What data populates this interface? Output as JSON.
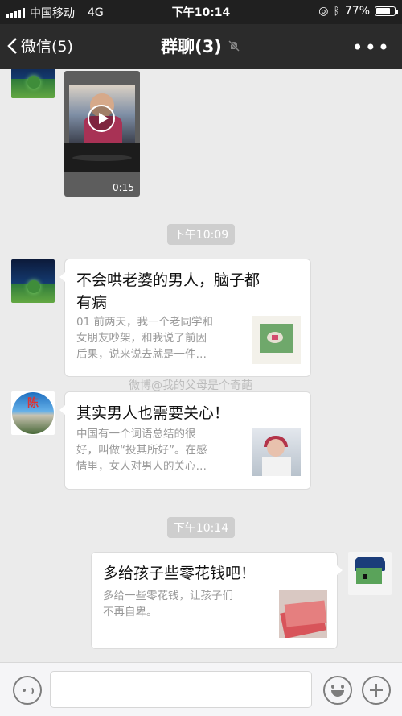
{
  "status_bar": {
    "carrier": "中国移动",
    "network": "4G",
    "time": "下午10:14",
    "battery_percent": "77%",
    "battery_level": 0.77
  },
  "nav": {
    "back_label": "微信(5)",
    "title": "群聊(3)",
    "more_label": "•••"
  },
  "messages": {
    "video_duration": "0:15",
    "timestamp_1": "下午10:09",
    "card_1": {
      "title_line_1": "不会哄老婆的男人，脑子都",
      "title_line_2": "有病",
      "desc_line_1": "01 前两天，我一个老同学和",
      "desc_line_2": "女朋友吵架，和我说了前因",
      "desc_line_3": "后果，说来说去就是一件…"
    },
    "watermark": "微博@我的父母是个奇葩",
    "card_2": {
      "title": "其实男人也需要关心！",
      "desc_line_1": "中国有一个词语总结的很",
      "desc_line_2": "好，叫做“投其所好”。在感",
      "desc_line_3": "情里，女人对男人的关心…",
      "avatar_char": "陈"
    },
    "timestamp_2": "下午10:14",
    "card_3": {
      "title": "多给孩子些零花钱吧！",
      "desc_line_1": "多给一些零花钱，让孩子们",
      "desc_line_2": "不再自卑。"
    }
  },
  "input_bar": {
    "placeholder": ""
  }
}
